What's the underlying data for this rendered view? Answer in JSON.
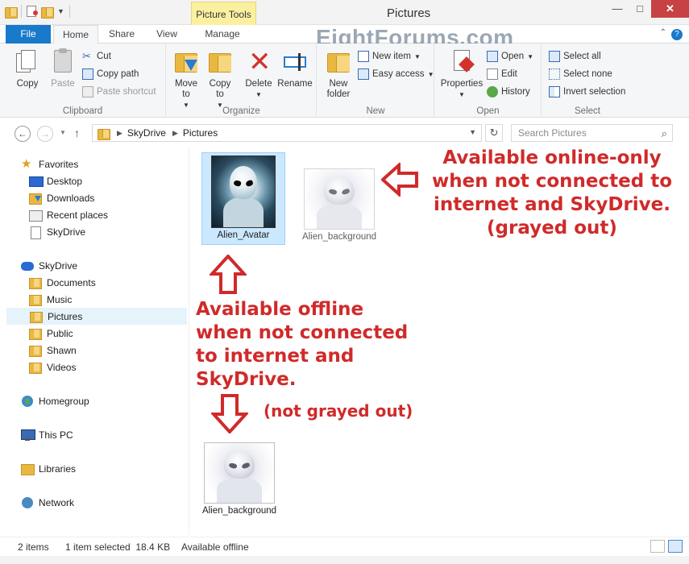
{
  "window": {
    "title": "Pictures",
    "context_tab": "Picture Tools",
    "watermark": "EightForums.com",
    "minimize": "—",
    "maximize": "□",
    "close": "✕"
  },
  "ribbon_tabs": [
    "File",
    "Home",
    "Share",
    "View",
    "Manage"
  ],
  "ribbon": {
    "clipboard": {
      "label": "Clipboard",
      "copy": "Copy",
      "paste": "Paste",
      "cut": "Cut",
      "copy_path": "Copy path",
      "paste_shortcut": "Paste shortcut"
    },
    "organize": {
      "label": "Organize",
      "move_to": "Move to",
      "copy_to": "Copy to",
      "delete": "Delete",
      "rename": "Rename"
    },
    "new": {
      "label": "New",
      "new_folder": "New folder",
      "new_item": "New item",
      "easy_access": "Easy access"
    },
    "open": {
      "label": "Open",
      "properties": "Properties",
      "open": "Open",
      "edit": "Edit",
      "history": "History"
    },
    "select": {
      "label": "Select",
      "select_all": "Select all",
      "select_none": "Select none",
      "invert_selection": "Invert selection"
    }
  },
  "address": {
    "path": [
      "SkyDrive",
      "Pictures"
    ],
    "search_placeholder": "Search Pictures"
  },
  "nav": {
    "favorites": {
      "label": "Favorites",
      "items": [
        "Desktop",
        "Downloads",
        "Recent places",
        "SkyDrive"
      ]
    },
    "skydrive": {
      "label": "SkyDrive",
      "items": [
        "Documents",
        "Music",
        "Pictures",
        "Public",
        "Shawn",
        "Videos"
      ],
      "selected": "Pictures"
    },
    "homegroup": "Homegroup",
    "this_pc": "This PC",
    "libraries": "Libraries",
    "network": "Network"
  },
  "files": [
    {
      "name": "Alien_Avatar",
      "selected": true,
      "style": "offline"
    },
    {
      "name": "Alien_background",
      "selected": false,
      "style": "online-only"
    }
  ],
  "example_file": {
    "name": "Alien_background"
  },
  "annotations": {
    "online_only": [
      "Available online-only",
      "when not connected to",
      "internet and SkyDrive.",
      "(grayed out)"
    ],
    "offline": [
      "Available offline",
      "when not connected",
      "to internet and",
      "SkyDrive."
    ],
    "not_grayed": "(not grayed out)",
    "color": "#d02a2a"
  },
  "status": {
    "items": "2 items",
    "selected": "1 item selected  18.4 KB",
    "availability": "Available offline"
  },
  "colors": {
    "file_tab": "#1979ca",
    "context_tab": "#fbf0a0",
    "selection": "#cce8ff",
    "close_button": "#c74343"
  }
}
